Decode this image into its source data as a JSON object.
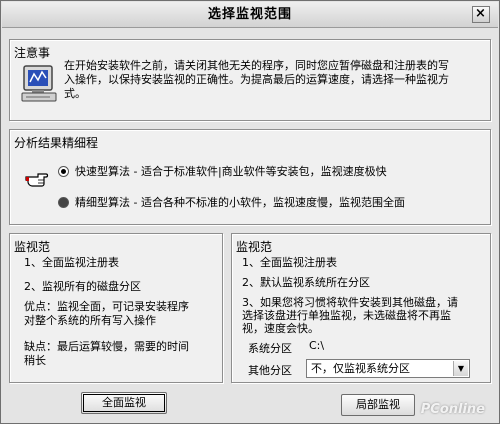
{
  "window": {
    "title": "选择监视范围",
    "close_label": "×"
  },
  "notice": {
    "title": "注意事",
    "line1": "在开始安装软件之前，请关闭其他无关的程序，同时您应暂停磁盘和注册表的写",
    "line2": "入操作，以保持安装监视的正确性。为提高最后的运算速度，请选择一种监视方",
    "line3": "式。"
  },
  "analysis": {
    "title": "分析结果精细程",
    "option_fast": "快速型算法 - 适合于标准软件|商业软件等安装包，监视速度极快",
    "option_fine": "精细型算法 - 适合各种不标准的小软件，监视速度慢，监视范围全面",
    "selected": "fast"
  },
  "full_panel": {
    "title": "监视范",
    "item1": "1、全面监视注册表",
    "item2": "2、监视所有的磁盘分区",
    "pros_line1": "优点：监视全面，可记录安装程序",
    "pros_line2": "对整个系统的所有写入操作",
    "cons_line1": "缺点：最后运算较慢，需要的时间",
    "cons_line2": "稍长"
  },
  "partial_panel": {
    "title": "监视范",
    "item1": "1、全面监视注册表",
    "item2": "2、默认监视系统所在分区",
    "item3_line1": "3、如果您将习惯将软件安装到其他磁盘，请",
    "item3_line2": "选择该盘进行单独监视，未选磁盘将不再监",
    "item3_line3": "视，速度会快。",
    "system_partition_label": "系统分区",
    "system_partition_value": "C:\\",
    "other_partition_label": "其他分区",
    "other_partition_value": "不，仅监视系统分区"
  },
  "buttons": {
    "full": "全面监视",
    "partial": "局部监视"
  },
  "watermark": "PConline"
}
